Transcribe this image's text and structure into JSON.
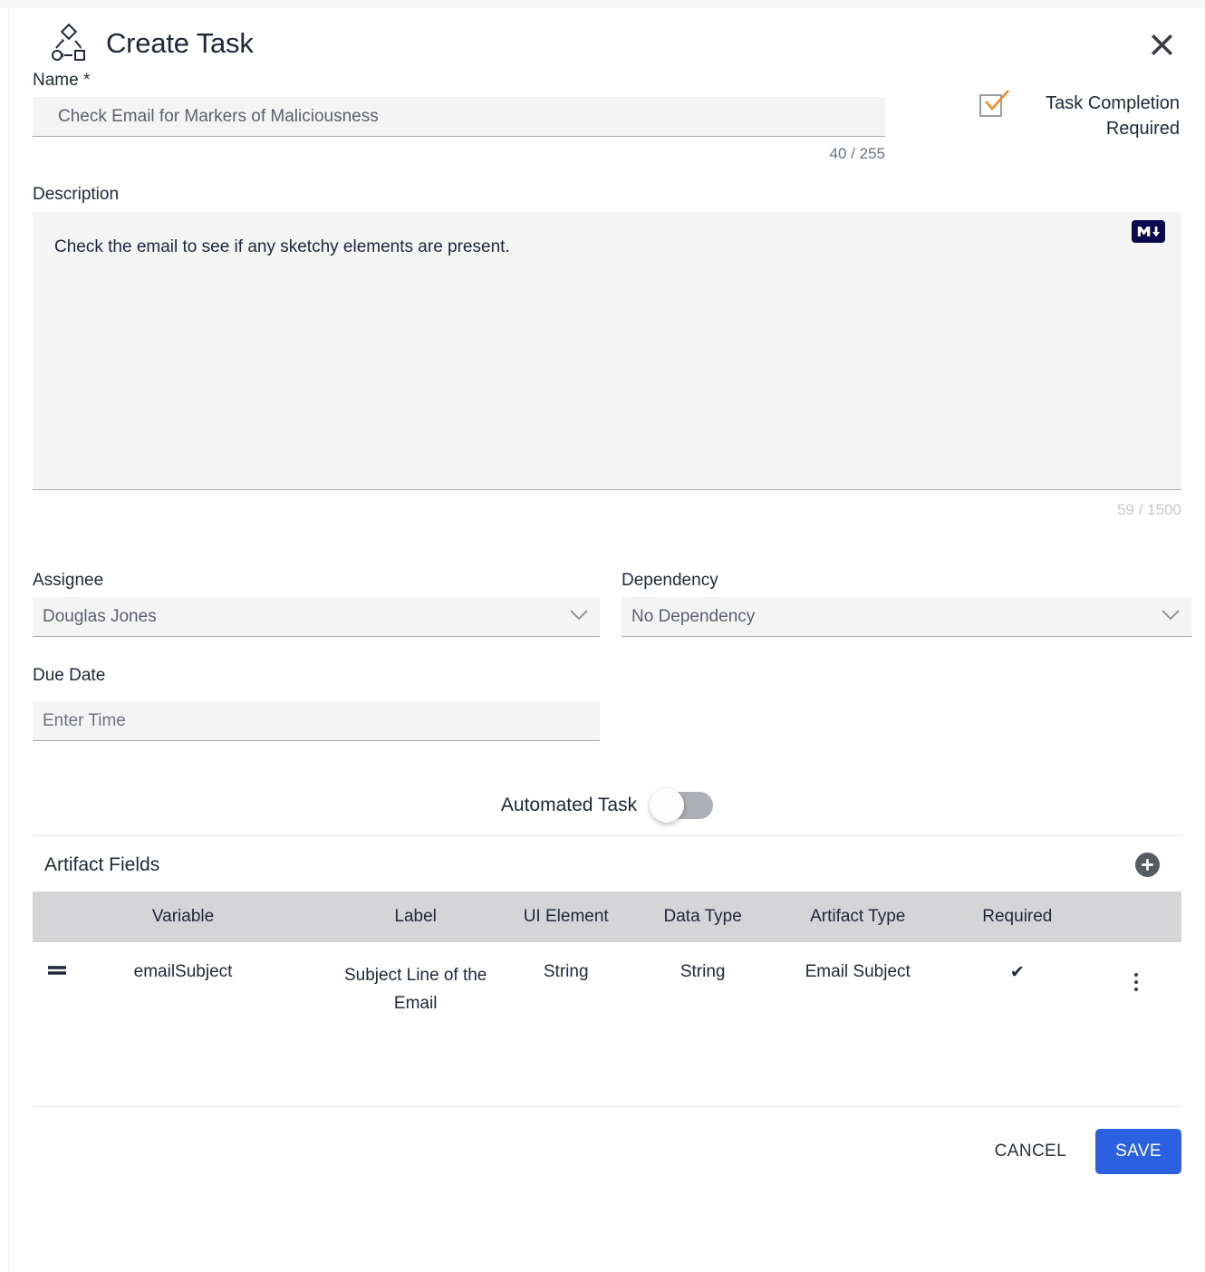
{
  "dialog": {
    "title": "Create Task",
    "icon": "workflow-icon",
    "close_icon": "close-icon"
  },
  "name_field": {
    "label": "Name *",
    "value": "Check Email for Markers of Maliciousness",
    "counter": "40 / 255"
  },
  "task_completion": {
    "label_line1": "Task Completion",
    "label_line2": "Required",
    "checked": true,
    "check_color": "#f08a24",
    "box_color": "#9a9ea6"
  },
  "description_field": {
    "label": "Description",
    "value": "Check the email to see if any sketchy elements are present.",
    "counter": "59 / 1500",
    "markdown_badge": "markdown-icon"
  },
  "assignee_field": {
    "label": "Assignee",
    "value": "Douglas Jones"
  },
  "dependency_field": {
    "label": "Dependency",
    "value": "No Dependency"
  },
  "due_date_field": {
    "label": "Due Date",
    "placeholder": "Enter Time",
    "value": ""
  },
  "automated_task": {
    "label": "Automated Task",
    "enabled": false
  },
  "artifact_fields": {
    "title": "Artifact Fields",
    "add_icon": "plus-icon",
    "columns": [
      "Variable",
      "Label",
      "UI Element",
      "Data Type",
      "Artifact Type",
      "Required"
    ],
    "rows": [
      {
        "drag_handle": "drag-handle-icon",
        "variable": "emailSubject",
        "label": "Subject Line of the Email",
        "ui_element": "String",
        "data_type": "String",
        "artifact_type": "Email Subject",
        "required": "✔",
        "menu_icon": "kebab-menu-icon"
      }
    ]
  },
  "footer": {
    "cancel_label": "CANCEL",
    "save_label": "SAVE",
    "save_color": "#2b61e0"
  }
}
